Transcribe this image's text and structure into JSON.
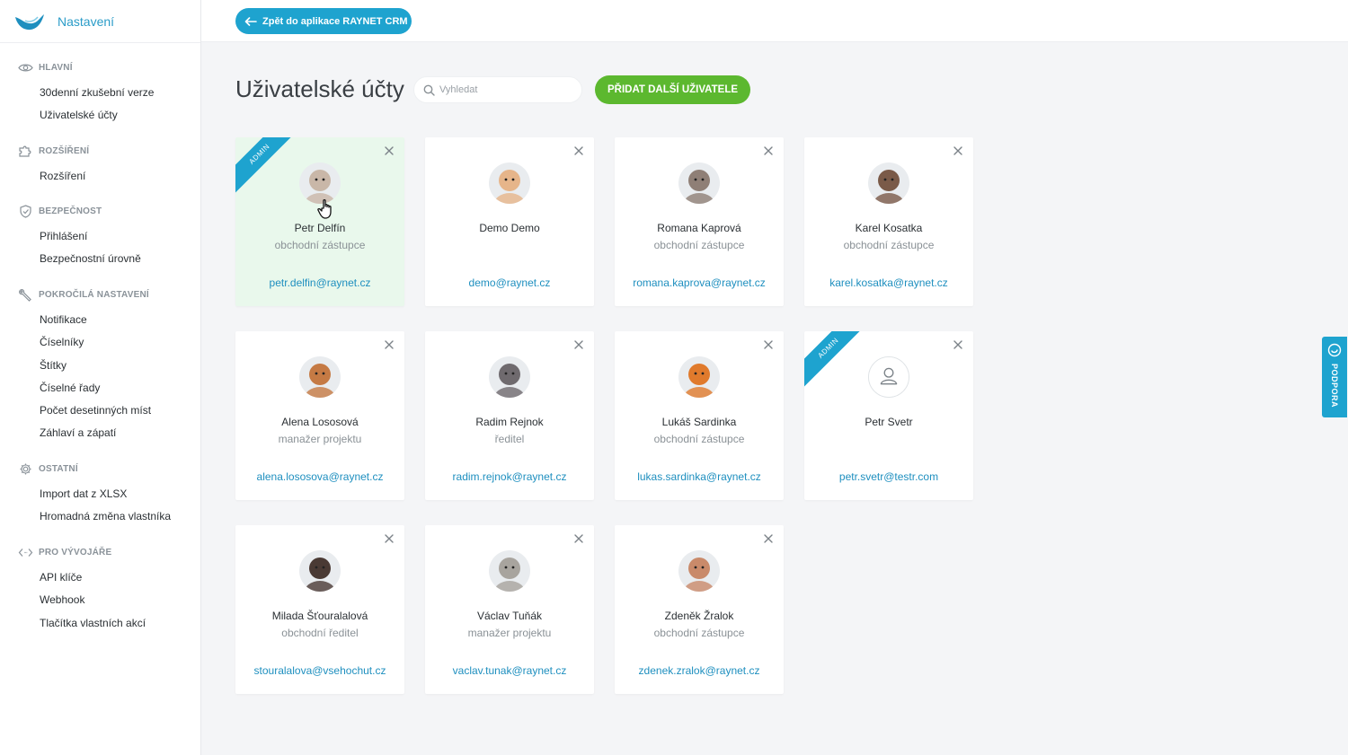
{
  "app": {
    "title": "Nastavení",
    "brand_color": "#1ea3cf"
  },
  "topbar": {
    "back_label": "Zpět do aplikace RAYNET CRM"
  },
  "sidebar": {
    "sections": [
      {
        "title": "HLAVNÍ",
        "icon": "eye-icon",
        "items": [
          "30denní zkušební verze",
          "Uživatelské účty"
        ]
      },
      {
        "title": "ROZŠÍŘENÍ",
        "icon": "puzzle-icon",
        "items": [
          "Rozšíření"
        ]
      },
      {
        "title": "BEZPEČNOST",
        "icon": "shield-icon",
        "items": [
          "Přihlášení",
          "Bezpečnostní úrovně"
        ]
      },
      {
        "title": "POKROČILÁ NASTAVENÍ",
        "icon": "wrench-icon",
        "items": [
          "Notifikace",
          "Číselníky",
          "Štítky",
          "Číselné řady",
          "Počet desetinných míst",
          "Záhlaví a zápatí"
        ]
      },
      {
        "title": "OSTATNÍ",
        "icon": "gear-icon",
        "items": [
          "Import dat z XLSX",
          "Hromadná změna vlastníka"
        ]
      },
      {
        "title": "PRO VÝVOJÁŘE",
        "icon": "code-icon",
        "items": [
          "API klíče",
          "Webhook",
          "Tlačítka vlastních akcí"
        ]
      }
    ]
  },
  "main": {
    "title": "Uživatelské účty",
    "search_placeholder": "Vyhledat",
    "add_button": "PŘIDAT DALŠÍ UŽIVATELE",
    "admin_badge": "ADMIN",
    "users": [
      {
        "name": "Petr Delfín",
        "role": "obchodní zástupce",
        "email": "petr.delfin@raynet.cz",
        "admin": true,
        "avatar": "#c9b7a8"
      },
      {
        "name": "Demo Demo",
        "role": "",
        "email": "demo@raynet.cz",
        "admin": false,
        "avatar": "#e6b58a"
      },
      {
        "name": "Romana Kaprová",
        "role": "obchodní zástupce",
        "email": "romana.kaprova@raynet.cz",
        "admin": false,
        "avatar": "#8f7f76"
      },
      {
        "name": "Karel Kosatka",
        "role": "obchodní zástupce",
        "email": "karel.kosatka@raynet.cz",
        "admin": false,
        "avatar": "#7a5a48"
      },
      {
        "name": "Alena Lososová",
        "role": "manažer projektu",
        "email": "alena.lososova@raynet.cz",
        "admin": false,
        "avatar": "#c57a44"
      },
      {
        "name": "Radim Rejnok",
        "role": "ředitel",
        "email": "radim.rejnok@raynet.cz",
        "admin": false,
        "avatar": "#6f6a6e"
      },
      {
        "name": "Lukáš Sardinka",
        "role": "obchodní zástupce",
        "email": "lukas.sardinka@raynet.cz",
        "admin": false,
        "avatar": "#e07a2c"
      },
      {
        "name": "Petr Svetr",
        "role": "",
        "email": "petr.svetr@testr.com",
        "admin": true,
        "avatar": ""
      },
      {
        "name": "Milada Šťouralalová",
        "role": "obchodní ředitel",
        "email": "stouralalova@vsehochut.cz",
        "admin": false,
        "avatar": "#4a3a34"
      },
      {
        "name": "Václav Tuňák",
        "role": "manažer projektu",
        "email": "vaclav.tunak@raynet.cz",
        "admin": false,
        "avatar": "#a8a49e"
      },
      {
        "name": "Zdeněk Žralok",
        "role": "obchodní zástupce",
        "email": "zdenek.zralok@raynet.cz",
        "admin": false,
        "avatar": "#c98a6a"
      }
    ]
  },
  "support": {
    "label": "PODPORA"
  }
}
